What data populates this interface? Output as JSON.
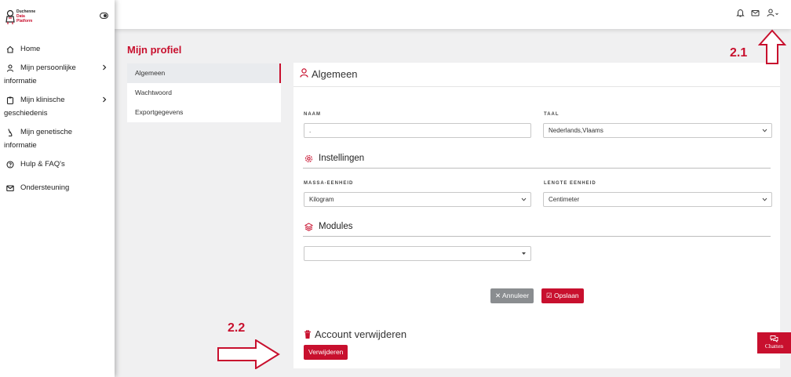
{
  "brand": {
    "line1": "Duchenne",
    "line2": "Data",
    "line3": "Platform",
    "accent": "#c8102e"
  },
  "sidebar": {
    "items": [
      {
        "label": "Home",
        "icon": "home-icon"
      },
      {
        "label": "Mijn persoonlijke",
        "label2": "informatie",
        "icon": "user-icon",
        "chevron": true
      },
      {
        "label": "Mijn klinische",
        "label2": "geschiedenis",
        "icon": "clipboard-icon",
        "chevron": true
      },
      {
        "label": "Mijn genetische",
        "label2": "informatie",
        "icon": "dna-icon"
      },
      {
        "label": "Hulp & FAQ's",
        "icon": "help-icon"
      },
      {
        "label": "Ondersteuning",
        "icon": "mail-icon"
      }
    ]
  },
  "topbar": {
    "icons": [
      "bell-icon",
      "mail-icon",
      "user-icon"
    ]
  },
  "page": {
    "title": "Mijn profiel"
  },
  "profile_menu": {
    "items": [
      "Algemeen",
      "Wachtwoord",
      "Exportgegevens"
    ],
    "active": 0
  },
  "card": {
    "title": "Algemeen",
    "name_label": "NAAM",
    "name_value": ".",
    "language_label": "TAAL",
    "language_value": "Nederlands,Vlaams",
    "settings_title": "Instellingen",
    "mass_label": "MASSA-EENHEID",
    "mass_value": "Kilogram",
    "length_label": "LENGTE EENHEID",
    "length_value": "Centimeter",
    "modules_title": "Modules",
    "modules_value": "",
    "cancel_label": "Annuleer",
    "save_label": "Opslaan",
    "delete_title": "Account verwijderen",
    "delete_label": "Verwijderen"
  },
  "annotations": {
    "a1": "2.1",
    "a2": "2.2"
  },
  "chat": {
    "label": "Chatten"
  }
}
